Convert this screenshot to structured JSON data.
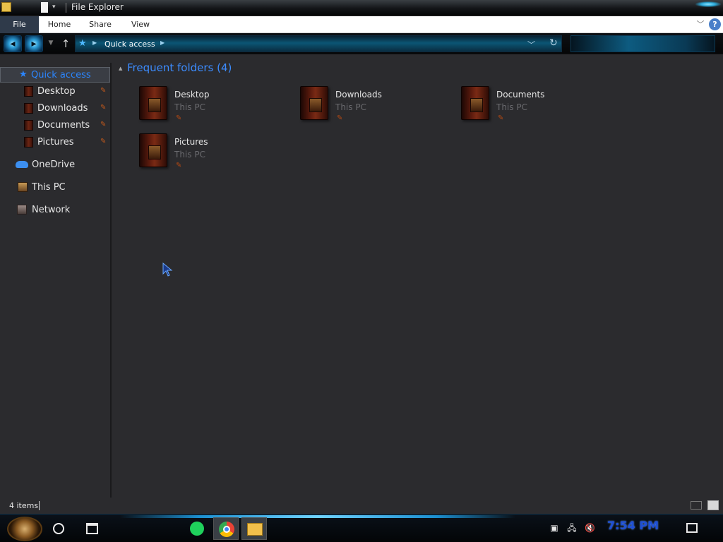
{
  "window": {
    "title": "File Explorer"
  },
  "ribbon": {
    "tabs": [
      {
        "label": "File"
      },
      {
        "label": "Home"
      },
      {
        "label": "Share"
      },
      {
        "label": "View"
      }
    ]
  },
  "address": {
    "crumb": "Quick access"
  },
  "sidebar": {
    "items": [
      {
        "label": "Quick access"
      },
      {
        "label": "Desktop"
      },
      {
        "label": "Downloads"
      },
      {
        "label": "Documents"
      },
      {
        "label": "Pictures"
      },
      {
        "label": "OneDrive"
      },
      {
        "label": "This PC"
      },
      {
        "label": "Network"
      }
    ]
  },
  "content": {
    "group_header": "Frequent folders (4)",
    "folders": [
      {
        "name": "Desktop",
        "location": "This PC"
      },
      {
        "name": "Downloads",
        "location": "This PC"
      },
      {
        "name": "Documents",
        "location": "This PC"
      },
      {
        "name": "Pictures",
        "location": "This PC"
      }
    ]
  },
  "status": {
    "item_count": "4 items"
  },
  "taskbar": {
    "clock": "7:54 PM",
    "apps": [
      "spotify",
      "chrome",
      "file-explorer"
    ]
  },
  "colors": {
    "accent": "#3c8cff",
    "background": "#2b2b2e",
    "pin": "#c45a1c"
  }
}
